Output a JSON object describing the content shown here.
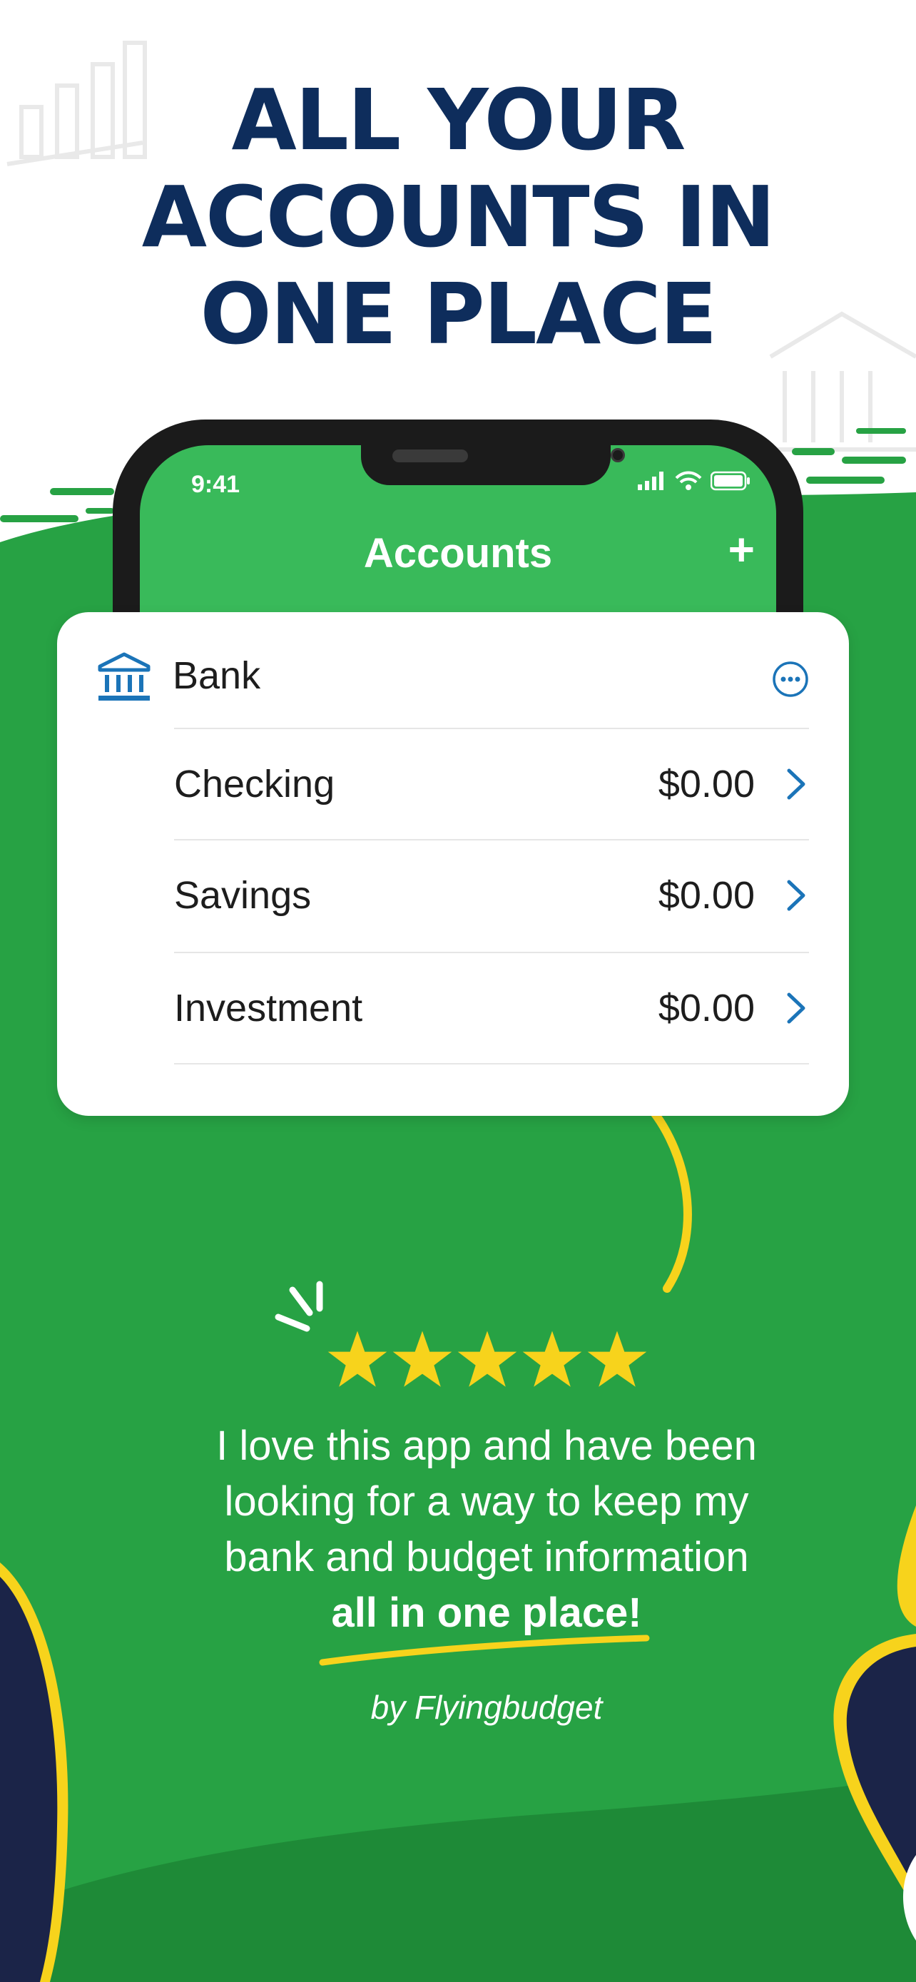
{
  "headline": {
    "line1": "ALL YOUR",
    "line2": "ACCOUNTS IN",
    "line3": "ONE PLACE"
  },
  "phone": {
    "status_time": "9:41",
    "nav_title": "Accounts",
    "add_label": "+"
  },
  "card": {
    "group_label": "Bank",
    "accounts": [
      {
        "name": "Checking",
        "amount": "$0.00"
      },
      {
        "name": "Savings",
        "amount": "$0.00"
      },
      {
        "name": "Investment",
        "amount": "$0.00"
      }
    ]
  },
  "review": {
    "rating": 5,
    "text_lines": [
      "I love this app and have been",
      "looking for a way to keep my",
      "bank and budget information"
    ],
    "highlight": "all in one place!",
    "byline": "by Flyingbudget"
  },
  "colors": {
    "navy": "#0e2d5c",
    "green_background": "#27a244",
    "phone_green": "#39ba5a",
    "accent_blue": "#1b74b8",
    "star_yellow": "#f7d31c"
  }
}
